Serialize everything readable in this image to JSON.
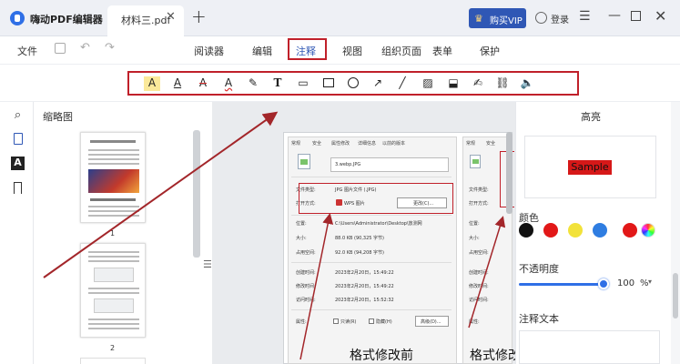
{
  "app": {
    "name": "嗨动PDF编辑器",
    "tab_name": "材料三.pdf",
    "new_tab": "+",
    "vip_label": "购买VIP",
    "login_label": "登录"
  },
  "menu": {
    "file": "文件",
    "tabs": [
      "阅读器",
      "编辑",
      "注释",
      "视图",
      "组织页面",
      "表单",
      "保护"
    ],
    "active_tab": "注释"
  },
  "toolbar": {
    "tools": [
      "highlight",
      "underline",
      "strikethrough",
      "squiggly",
      "pencil",
      "text",
      "note",
      "rectangle",
      "ellipse",
      "arrow",
      "line",
      "image",
      "stamp",
      "signature",
      "link",
      "audio"
    ],
    "glyphs": {
      "highlight": "A",
      "underline": "A",
      "strike": "A",
      "squiggly": "A",
      "pen": "✎",
      "text": "T",
      "note": "▭",
      "arrow": "↗",
      "line": "╱",
      "img": "▨",
      "stamp": "⬓",
      "sign": "✍",
      "link": "⛓",
      "audio": "🔈"
    }
  },
  "sidebar": {
    "title": "缩略图",
    "pages": [
      "1",
      "2"
    ]
  },
  "document": {
    "dialog_before": {
      "tabs": [
        "常规",
        "安全",
        "属性修改",
        "详细信息",
        "以前的版本"
      ],
      "filename": "3.webp.JPG",
      "rows": [
        {
          "key": "文件类型:",
          "value": "JPG 图片文件 (.JPG)"
        },
        {
          "key": "打开方式:",
          "value": "WPS 图片"
        },
        {
          "key": "位置:",
          "value": "C:\\Users\\Administrator\\Desktop\\放测网"
        },
        {
          "key": "大小:",
          "value": "88.0 KB (90,325 字节)"
        },
        {
          "key": "占用空间:",
          "value": "92.0 KB (94,208 字节)"
        },
        {
          "key": "创建时间:",
          "value": "2023年2月20日，15:49:22"
        },
        {
          "key": "修改时间:",
          "value": "2023年2月20日，15:49:22"
        },
        {
          "key": "访问时间:",
          "value": "2023年2月20日，15:52:32"
        },
        {
          "key": "属性:",
          "value": ""
        }
      ],
      "change_button": "更改(C)...",
      "readonly_label": "只读(R)",
      "hidden_label": "隐藏(H)",
      "advanced_button": "高级(D)...",
      "caption": "格式修改前"
    },
    "dialog_after": {
      "tabs": [
        "常规",
        "安全"
      ],
      "rows": [
        "文件类型:",
        "打开方式:",
        "位置:",
        "大小:",
        "占用空间:",
        "创建时间:",
        "修改时间:",
        "访问时间:",
        "属性:"
      ],
      "caption": "格式修改后"
    }
  },
  "right_panel": {
    "title": "高亮",
    "preview_text": "Sample",
    "color_label": "颜色",
    "colors": [
      "#111111",
      "#e21818",
      "#f2e23a",
      "#2f7de1",
      "#e21818"
    ],
    "opacity_label": "不透明度",
    "opacity_value": "100",
    "opacity_unit": "%",
    "note_label": "注释文本"
  },
  "highlight_color": "#c0202a",
  "accent": "#2f57b5"
}
